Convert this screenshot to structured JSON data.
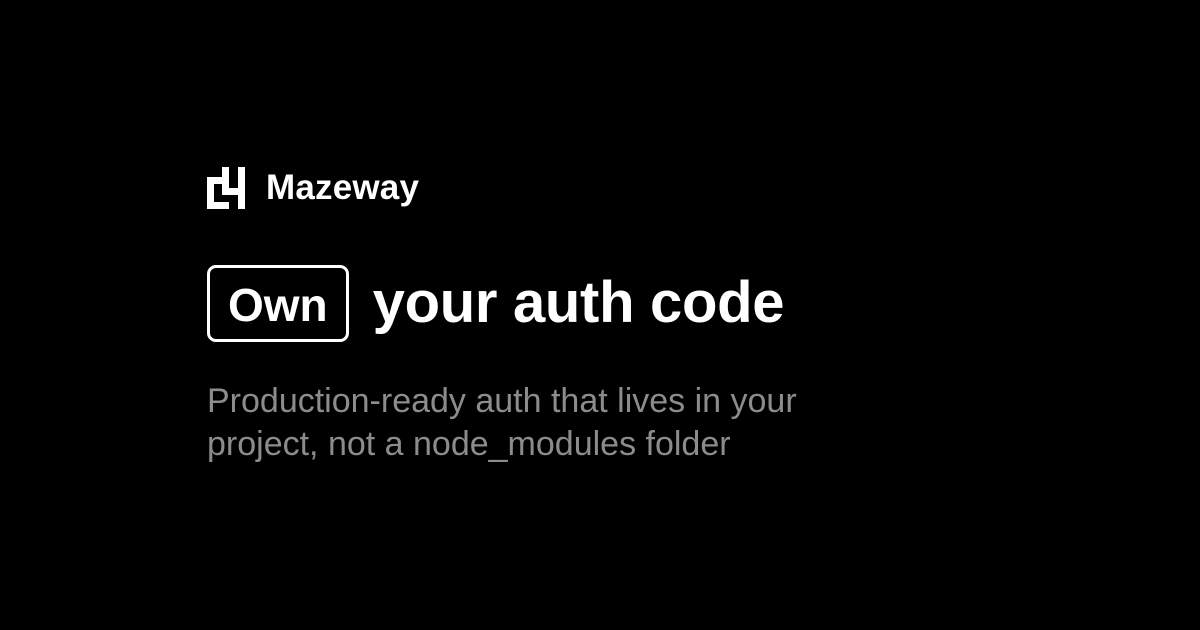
{
  "brand": {
    "name": "Mazeway",
    "logo_icon": "maze-logo-icon"
  },
  "headline": {
    "highlight": "Own",
    "rest": "your auth code"
  },
  "subtitle": {
    "line1": "Production-ready auth that lives in your",
    "line2": "project, not a node_modules folder"
  },
  "colors": {
    "background": "#000000",
    "text": "#ffffff",
    "muted": "#8c8c8c"
  }
}
